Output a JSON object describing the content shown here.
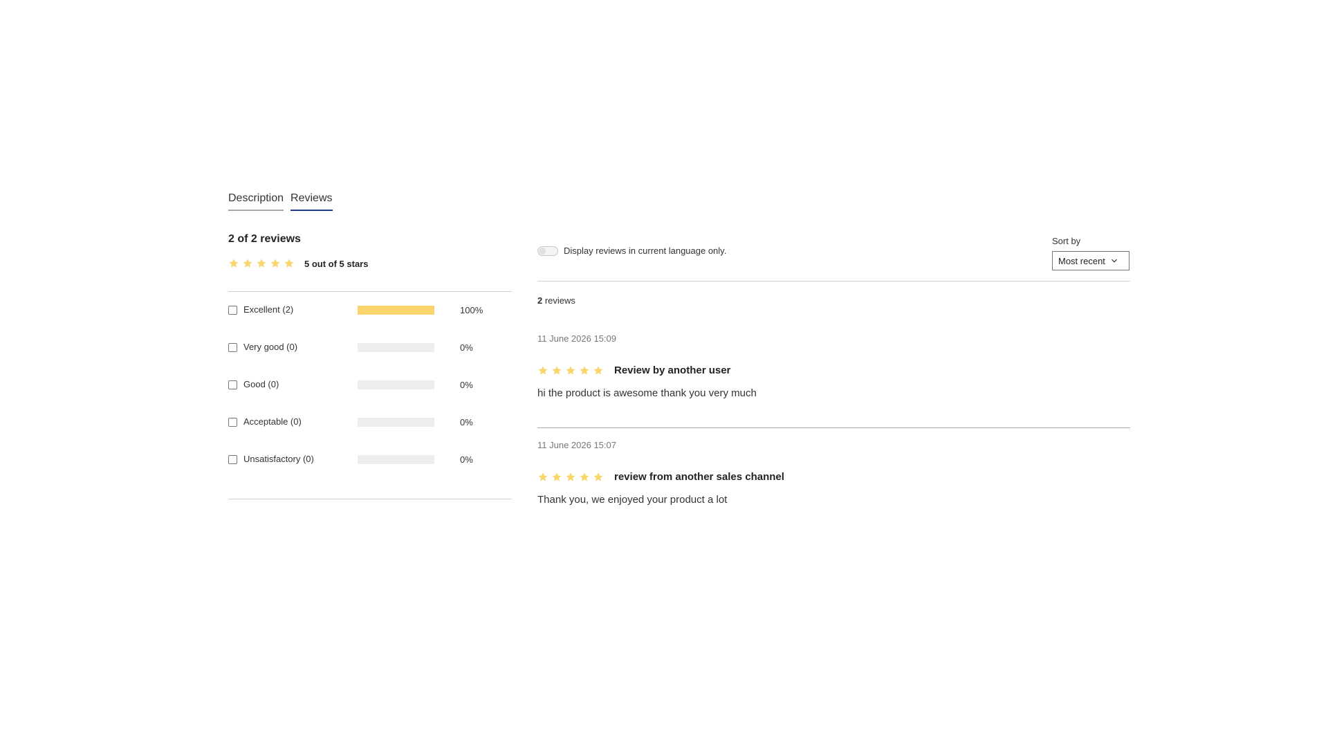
{
  "tabs": [
    {
      "label": "Description",
      "active": false
    },
    {
      "label": "Reviews",
      "active": true
    }
  ],
  "summary": {
    "title": "2 of 2 reviews",
    "rating": 5,
    "rating_label": "5 out of 5 stars"
  },
  "filters": [
    {
      "label": "Excellent (2)",
      "percent_label": "100%",
      "fill": 1.0,
      "checked": false
    },
    {
      "label": "Very good (0)",
      "percent_label": "0%",
      "fill": 0.0,
      "checked": false
    },
    {
      "label": "Good (0)",
      "percent_label": "0%",
      "fill": 0.0,
      "checked": false
    },
    {
      "label": "Acceptable (0)",
      "percent_label": "0%",
      "fill": 0.0,
      "checked": false
    },
    {
      "label": "Unsatisfactory (0)",
      "percent_label": "0%",
      "fill": 0.0,
      "checked": false
    }
  ],
  "language_toggle": {
    "label": "Display reviews in current language only.",
    "on": false
  },
  "sort": {
    "label": "Sort by",
    "selected": "Most recent"
  },
  "reviews_count": {
    "number": "2",
    "suffix": " reviews"
  },
  "reviews": [
    {
      "date": "11 June 2026 15:09",
      "rating": 5,
      "title": "Review by another user",
      "body": "hi the product is awesome thank you very much"
    },
    {
      "date": "11 June 2026 15:07",
      "rating": 5,
      "title": "review from another sales channel",
      "body": "Thank you, we enjoyed your product a lot"
    }
  ],
  "colors": {
    "star": "#f9d56b",
    "bar_fill": "#f9d56b",
    "bar_track": "#eeeeee",
    "active_tab": "#1b3d8f"
  }
}
